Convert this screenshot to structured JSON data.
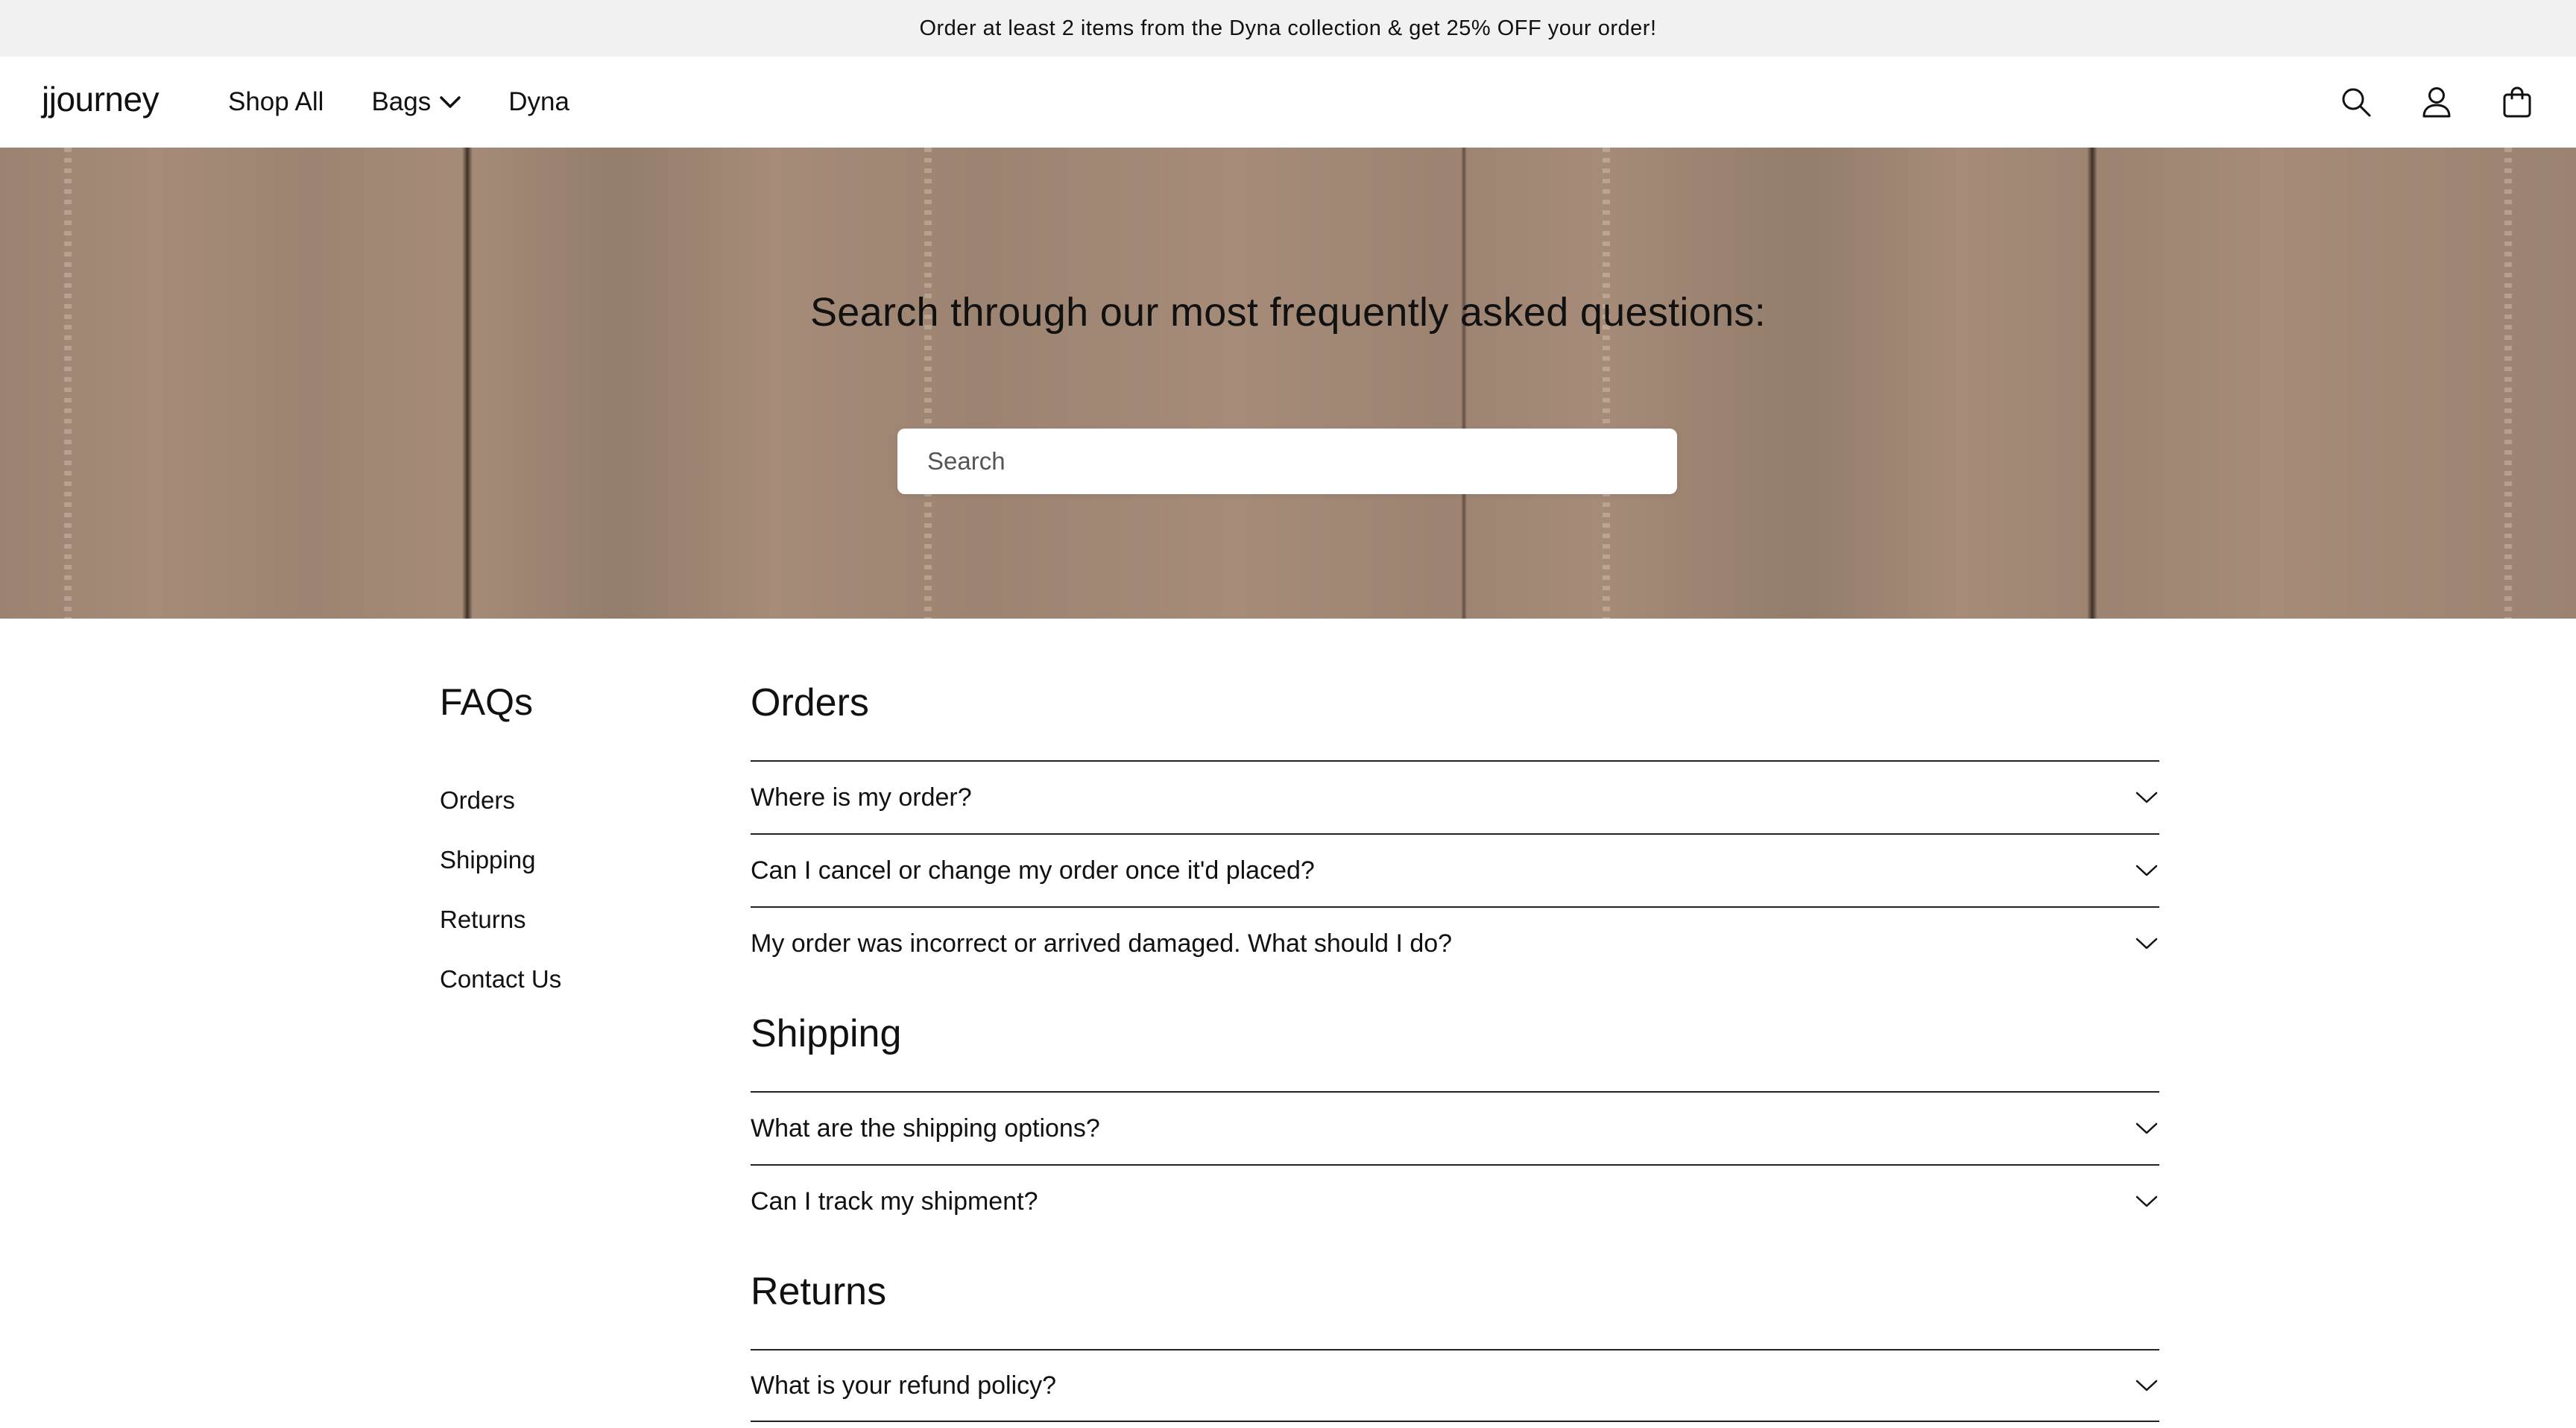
{
  "announcement": {
    "text": "Order at least 2 items from the Dyna collection & get 25% OFF your order!"
  },
  "header": {
    "logo": "jjourney",
    "nav": [
      {
        "label": "Shop All",
        "icon": null
      },
      {
        "label": "Bags",
        "icon": "chevron-down-icon"
      },
      {
        "label": "Dyna",
        "icon": null
      }
    ],
    "icons": [
      "search-icon",
      "account-icon",
      "cart-icon"
    ]
  },
  "hero": {
    "title": "Search through our most frequently asked questions:",
    "search_placeholder": "Search",
    "search_value": ""
  },
  "faq": {
    "heading": "FAQs",
    "sidebar": [
      {
        "label": "Orders"
      },
      {
        "label": "Shipping"
      },
      {
        "label": "Returns"
      },
      {
        "label": "Contact Us"
      }
    ],
    "sections": [
      {
        "title": "Orders",
        "questions": [
          "Where is my order?",
          "Can I cancel or change my order once it'd placed?",
          "My order was incorrect or arrived damaged. What should I do?"
        ]
      },
      {
        "title": "Shipping",
        "questions": [
          "What are the shipping options?",
          "Can I track my shipment?"
        ]
      },
      {
        "title": "Returns",
        "questions": [
          "What is your refund policy?"
        ]
      }
    ]
  }
}
